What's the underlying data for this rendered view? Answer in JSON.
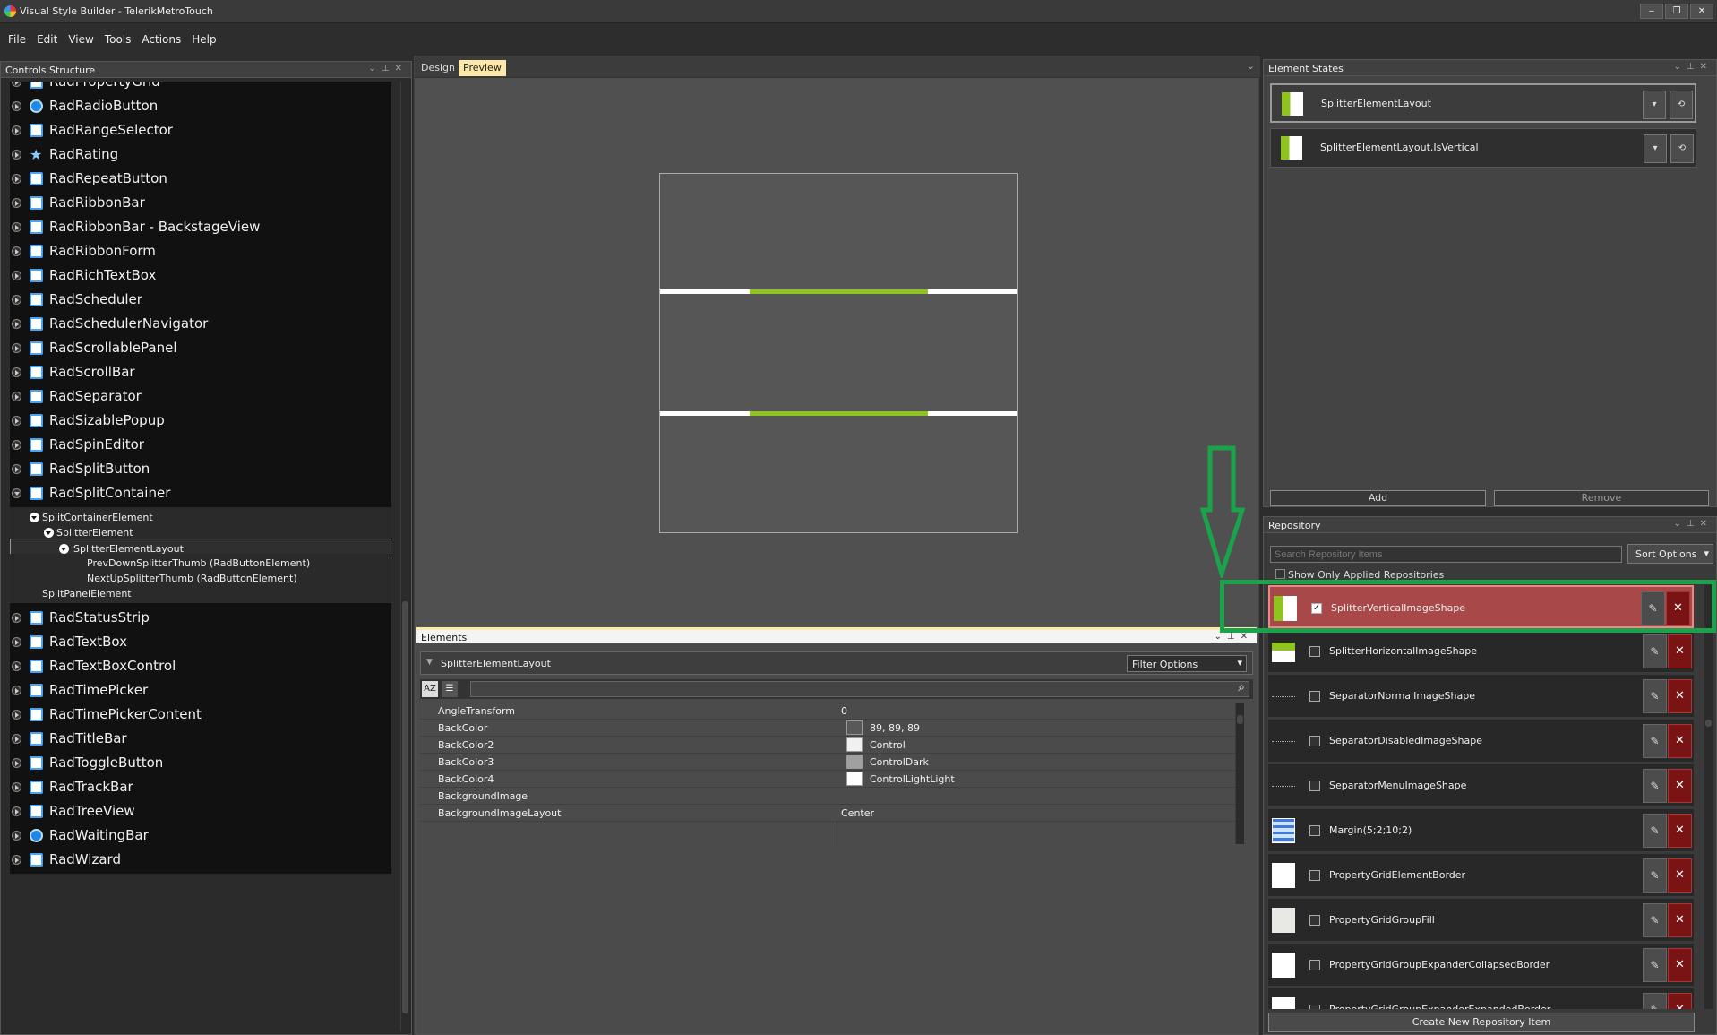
{
  "window": {
    "title": "Visual Style Builder - TelerikMetroTouch",
    "min": "‒",
    "restore": "❐",
    "close": "✕"
  },
  "menu": [
    "File",
    "Edit",
    "View",
    "Tools",
    "Actions",
    "Help"
  ],
  "controls_structure": {
    "title": "Controls Structure",
    "items": [
      "RadPropertyGrid",
      "RadRadioButton",
      "RadRangeSelector",
      "RadRating",
      "RadRepeatButton",
      "RadRibbonBar",
      "RadRibbonBar - BackstageView",
      "RadRibbonForm",
      "RadRichTextBox",
      "RadScheduler",
      "RadSchedulerNavigator",
      "RadScrollablePanel",
      "RadScrollBar",
      "RadSeparator",
      "RadSizablePopup",
      "RadSpinEditor",
      "RadSplitButton",
      "RadSplitContainer"
    ],
    "sub_items": [
      "SplitContainerElement",
      "SplitterElement",
      "SplitterElementLayout",
      "PrevDownSplitterThumb (RadButtonElement)",
      "NextUpSplitterThumb (RadButtonElement)",
      "SplitPanelElement"
    ],
    "items_after": [
      "RadStatusStrip",
      "RadTextBox",
      "RadTextBoxControl",
      "RadTimePicker",
      "RadTimePickerContent",
      "RadTitleBar",
      "RadToggleButton",
      "RadTrackBar",
      "RadTreeView",
      "RadWaitingBar",
      "RadWizard"
    ]
  },
  "tabs": [
    "Design",
    "Preview"
  ],
  "elements": {
    "title": "Elements",
    "selected": "SplitterElementLayout",
    "filter_label": "Filter Options",
    "properties": [
      {
        "name": "AngleTransform",
        "value": "0"
      },
      {
        "name": "BackColor",
        "value": "89, 89, 89",
        "swatch": "#595959"
      },
      {
        "name": "BackColor2",
        "value": "Control",
        "swatch": "#f0f0f0"
      },
      {
        "name": "BackColor3",
        "value": "ControlDark",
        "swatch": "#a0a0a0"
      },
      {
        "name": "BackColor4",
        "value": "ControlLightLight",
        "swatch": "#ffffff"
      },
      {
        "name": "BackgroundImage",
        "value": ""
      },
      {
        "name": "BackgroundImageLayout",
        "value": "Center"
      }
    ]
  },
  "element_states": {
    "title": "Element States",
    "states": [
      "SplitterElementLayout",
      "SplitterElementLayout.IsVertical"
    ],
    "add_label": "Add",
    "remove_label": "Remove"
  },
  "repository": {
    "title": "Repository",
    "search_placeholder": "Search Repository Items",
    "sort_label": "Sort Options",
    "show_only_label": "Show Only Applied Repositories",
    "create_label": "Create New Repository Item",
    "items": [
      {
        "label": "SplitterVerticalImageShape",
        "checked": true
      },
      {
        "label": "SplitterHorizontalImageShape",
        "checked": false
      },
      {
        "label": "SeparatorNormalImageShape",
        "checked": false
      },
      {
        "label": "SeparatorDisabledImageShape",
        "checked": false
      },
      {
        "label": "SeparatorMenuImageShape",
        "checked": false
      },
      {
        "label": "Margin(5;2;10;2)",
        "checked": false
      },
      {
        "label": "PropertyGridElementBorder",
        "checked": false
      },
      {
        "label": "PropertyGridGroupFill",
        "checked": false
      },
      {
        "label": "PropertyGridGroupExpanderCollapsedBorder",
        "checked": false
      },
      {
        "label": "PropertyGridGroupExpanderExpandedBorder",
        "checked": false
      }
    ]
  },
  "colors": {
    "accent_green": "#8fc31f",
    "annotation_green": "#1aa34a",
    "selected_red": "#a84848"
  }
}
